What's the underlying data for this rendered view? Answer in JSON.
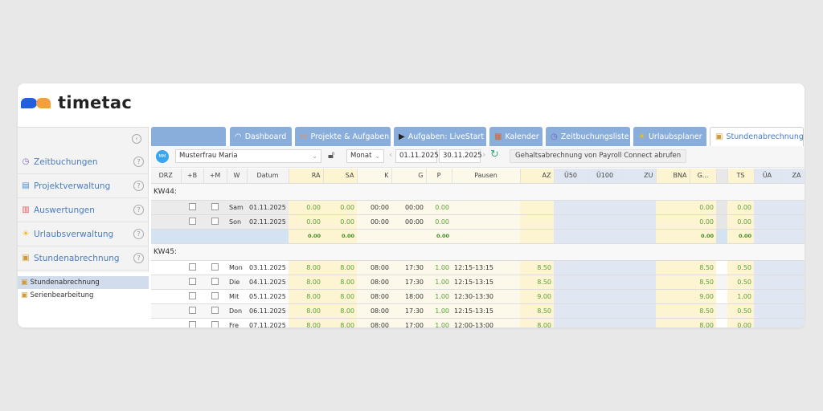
{
  "brand": {
    "name": "timetac",
    "colors": {
      "blue": "#1f5fe0",
      "orange": "#f4a03a"
    }
  },
  "sidebar": {
    "collapse_icon": "chevron-left-circle-icon",
    "items": [
      {
        "label": "Zeitbuchungen",
        "icon": "clock-icon"
      },
      {
        "label": "Projektverwaltung",
        "icon": "clipboard-icon"
      },
      {
        "label": "Auswertungen",
        "icon": "bar-chart-icon"
      },
      {
        "label": "Urlaubsverwaltung",
        "icon": "sun-icon"
      },
      {
        "label": "Stundenabrechnung",
        "icon": "badge-clipboard-icon"
      }
    ],
    "subitems": [
      {
        "label": "Stundenabrechnung",
        "active": true
      },
      {
        "label": "Serienbearbeitung",
        "active": false
      }
    ]
  },
  "tabs": [
    {
      "label": "Dashboard",
      "icon": "gauge-icon"
    },
    {
      "label": "Projekte & Aufgaben",
      "icon": "folder-icon"
    },
    {
      "label": "Aufgaben: LiveStart",
      "icon": "play-icon"
    },
    {
      "label": "Kalender",
      "icon": "calendar-icon"
    },
    {
      "label": "Zeitbuchungsliste",
      "icon": "clock-icon"
    },
    {
      "label": "Urlaubsplaner",
      "icon": "sun-icon"
    },
    {
      "label": "Stundenabrechnung",
      "icon": "badge-clipboard-icon",
      "active": true
    }
  ],
  "toolbar": {
    "avatar": "MM",
    "user": "Musterfrau Maria",
    "period": "Monat",
    "from": "01.11.2025",
    "to": "30.11.2025",
    "payroll_button": "Gehaltsabrechnung von Payroll Connect abrufen"
  },
  "table": {
    "columns": [
      "DRZ",
      "+B",
      "+M",
      "W",
      "Datum",
      "RA",
      "SA",
      "K",
      "G",
      "P",
      "Pausen",
      "AZ",
      "Ü50",
      "Ü100",
      "ZU",
      "BNA",
      "G...",
      "",
      "TS",
      "ÜA",
      "ZA"
    ],
    "weeks": [
      {
        "label": "KW44:",
        "rows": [
          {
            "w": "Sam",
            "date": "01.11.2025",
            "ra": "0.00",
            "sa": "0.00",
            "k": "00:00",
            "g": "00:00",
            "p": "0.00",
            "pausen": "",
            "az": "",
            "gx": "0.00",
            "ts": "0.00",
            "weekend": true
          },
          {
            "w": "Son",
            "date": "02.11.2025",
            "ra": "0.00",
            "sa": "0.00",
            "k": "00:00",
            "g": "00:00",
            "p": "0.00",
            "pausen": "",
            "az": "",
            "gx": "0.00",
            "ts": "0.00",
            "weekend": true
          }
        ],
        "sum": {
          "ra": "0.00",
          "sa": "0.00",
          "p": "0.00",
          "gx": "0.00",
          "ts": "0.00"
        }
      },
      {
        "label": "KW45:",
        "rows": [
          {
            "w": "Mon",
            "date": "03.11.2025",
            "ra": "8.00",
            "sa": "8.00",
            "k": "08:00",
            "g": "17:30",
            "p": "1.00",
            "pausen": "12:15-13:15",
            "az": "8.50",
            "gx": "8.50",
            "ts": "0.50"
          },
          {
            "w": "Die",
            "date": "04.11.2025",
            "ra": "8.00",
            "sa": "8.00",
            "k": "08:00",
            "g": "17:30",
            "p": "1.00",
            "pausen": "12:15-13:15",
            "az": "8.50",
            "gx": "8.50",
            "ts": "0.50"
          },
          {
            "w": "Mit",
            "date": "05.11.2025",
            "ra": "8.00",
            "sa": "8.00",
            "k": "08:00",
            "g": "18:00",
            "p": "1.00",
            "pausen": "12:30-13:30",
            "az": "9.00",
            "gx": "9.00",
            "ts": "1.00"
          },
          {
            "w": "Don",
            "date": "06.11.2025",
            "ra": "8.00",
            "sa": "8.00",
            "k": "08:00",
            "g": "17:30",
            "p": "1.00",
            "pausen": "12:15-13:15",
            "az": "8.50",
            "gx": "8.50",
            "ts": "0.50"
          },
          {
            "w": "Fre",
            "date": "07.11.2025",
            "ra": "8.00",
            "sa": "8.00",
            "k": "08:00",
            "g": "17:00",
            "p": "1.00",
            "pausen": "12:00-13:00",
            "az": "8.00",
            "gx": "8.00",
            "ts": "0.00"
          }
        ]
      }
    ]
  }
}
